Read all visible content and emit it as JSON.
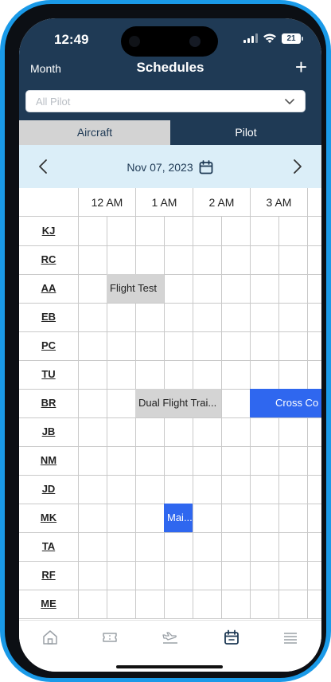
{
  "status_bar": {
    "time": "12:49",
    "battery": "21"
  },
  "nav": {
    "left_label": "Month",
    "title": "Schedules",
    "add_label": "+"
  },
  "filter": {
    "value": "All Pilot"
  },
  "tabs": [
    {
      "label": "Aircraft",
      "active": false
    },
    {
      "label": "Pilot",
      "active": true
    }
  ],
  "date_bar": {
    "date": "Nov 07, 2023"
  },
  "hours": [
    "12 AM",
    "1 AM",
    "2 AM",
    "3 AM"
  ],
  "pilots": [
    "KJ",
    "RC",
    "AA",
    "EB",
    "PC",
    "TU",
    "BR",
    "JB",
    "NM",
    "JD",
    "MK",
    "TA",
    "RF",
    "ME"
  ],
  "events": [
    {
      "pilot": "AA",
      "label": "Flight Test",
      "color": "grey"
    },
    {
      "pilot": "BR",
      "label": "Dual Flight Trai...",
      "color": "grey"
    },
    {
      "pilot": "BR",
      "label": "Cross Co",
      "color": "blue"
    },
    {
      "pilot": "MK",
      "label": "Mai...",
      "color": "blue"
    }
  ],
  "colors": {
    "header": "#1f3a55",
    "date_bar": "#dbeef8",
    "event_blue": "#2f67ef",
    "event_grey": "#d4d4d4",
    "frame": "#1a9ae8"
  },
  "bottom_nav": [
    "home-icon",
    "ticket-icon",
    "airplane-icon",
    "calendar-icon",
    "menu-icon"
  ]
}
